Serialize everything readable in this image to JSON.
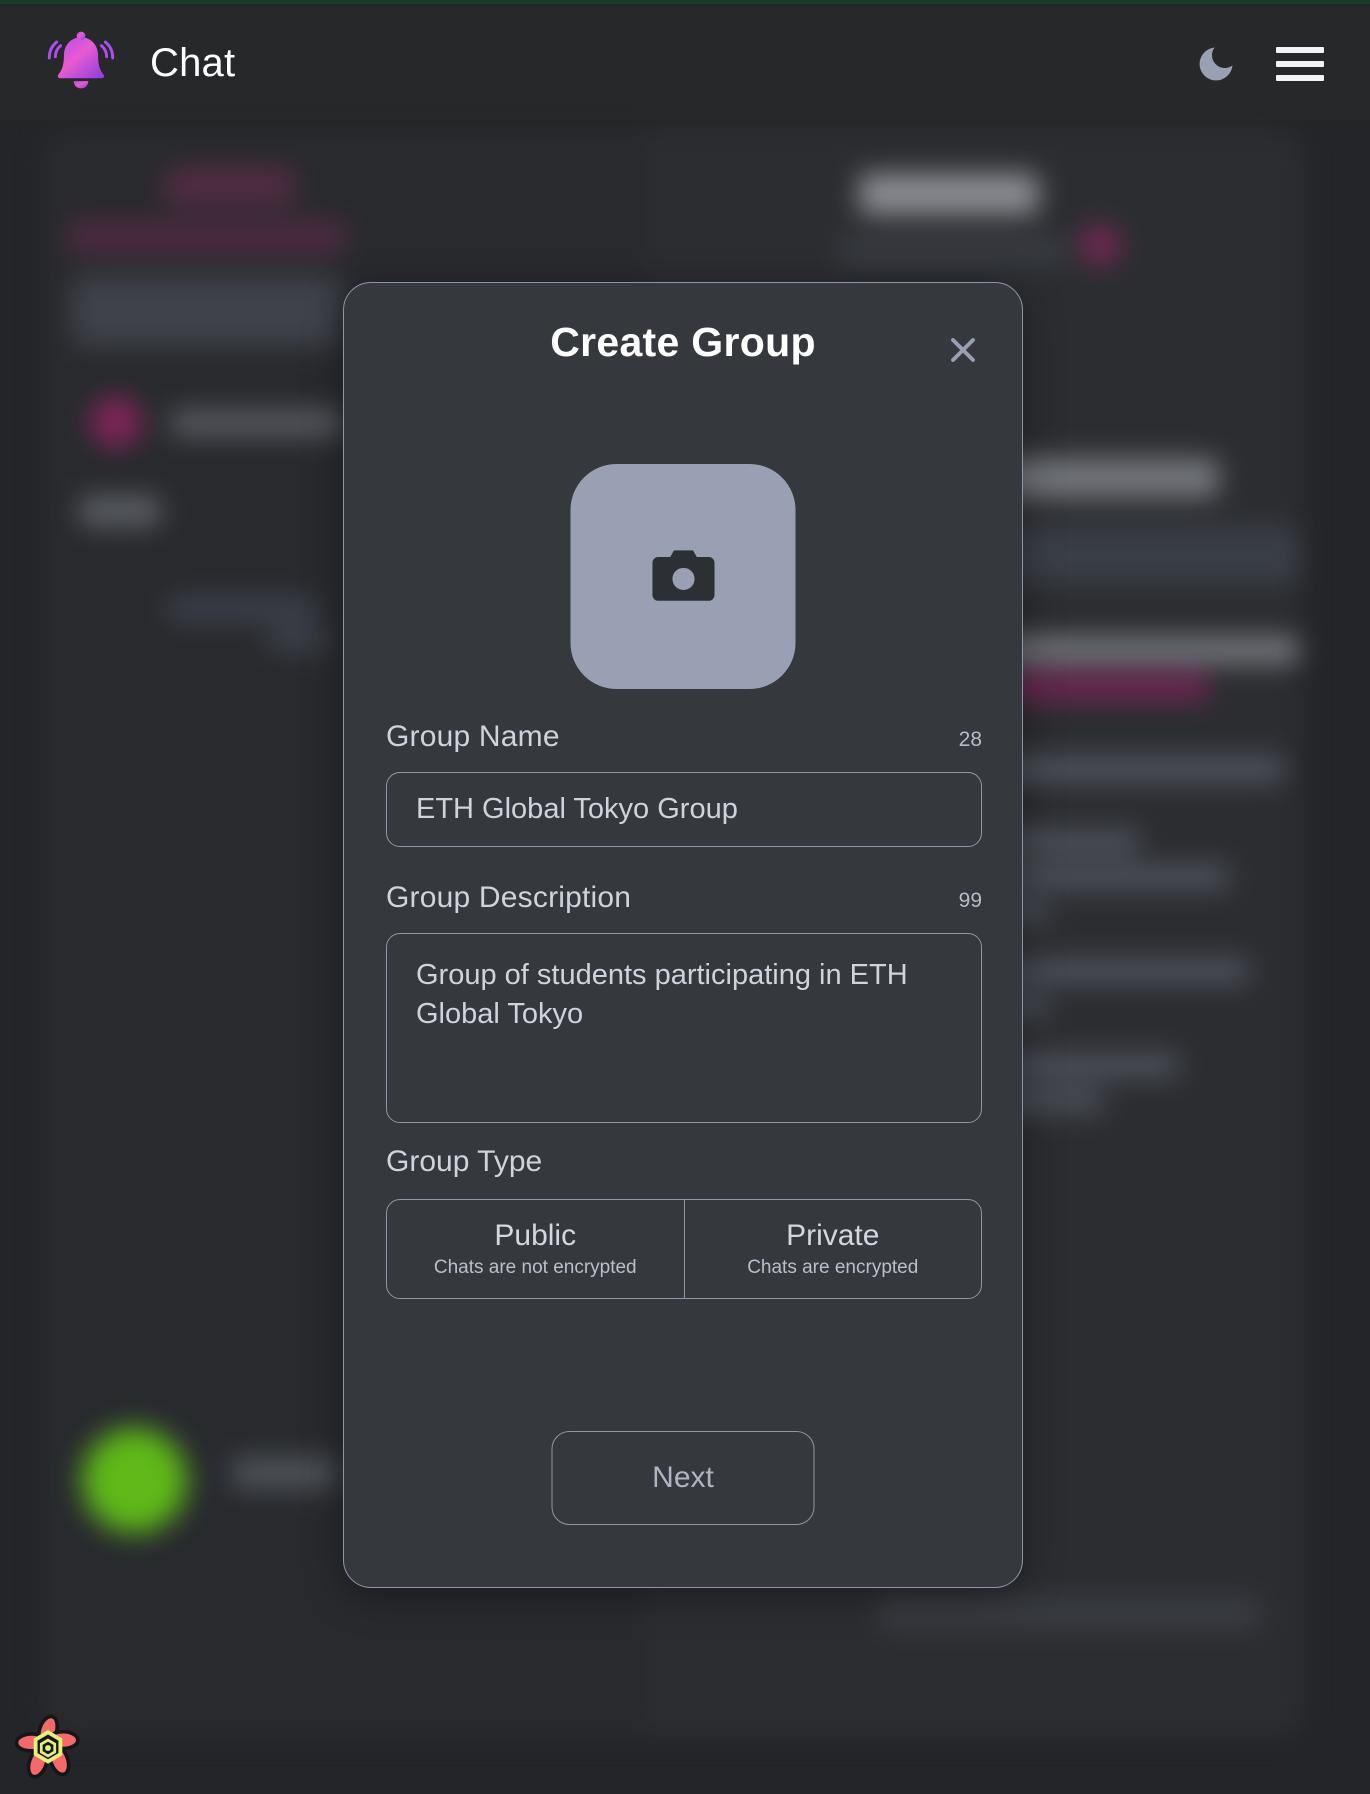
{
  "header": {
    "title": "Chat",
    "bell_icon": "notification-bell-icon",
    "theme_icon": "moon-icon",
    "menu_icon": "hamburger-menu-icon"
  },
  "modal": {
    "title": "Create Group",
    "close_icon": "close-x-icon",
    "avatar": {
      "icon": "camera-icon",
      "bg_color": "#9aa0b4"
    },
    "group_name": {
      "label": "Group Name",
      "counter": "28",
      "value": "ETH Global Tokyo Group",
      "placeholder": "Group Name"
    },
    "group_description": {
      "label": "Group Description",
      "counter": "99",
      "value": "Group of students participating in ETH Global Tokyo",
      "placeholder": "Group Description"
    },
    "group_type": {
      "label": "Group Type",
      "options": [
        {
          "title": "Public",
          "subtitle": "Chats are not encrypted"
        },
        {
          "title": "Private",
          "subtitle": "Chats are encrypted"
        }
      ]
    },
    "next_label": "Next"
  },
  "footer": {
    "devtools_icon": "react-query-flower-icon"
  },
  "colors": {
    "page_bg": "#232528",
    "header_bg": "#262829",
    "modal_bg": "#35383c",
    "modal_border": "#8f96a8",
    "accent_pink": "#cd2a7d",
    "accent_purple": "#a855f7",
    "top_strip_green": "#1b3a2a",
    "online_green": "#63c119"
  }
}
